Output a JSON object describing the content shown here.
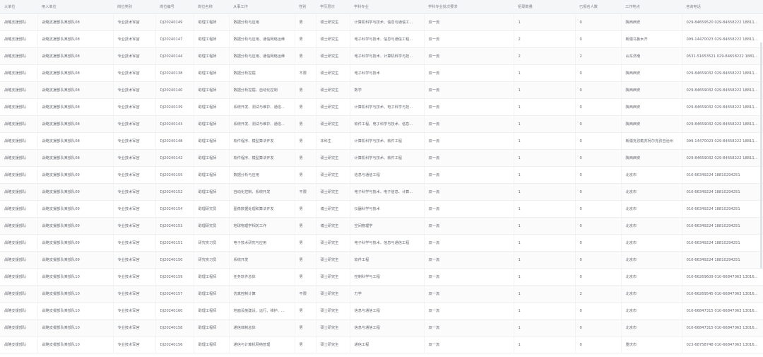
{
  "columns": [
    "大单位",
    "用人单位",
    "岗位类别",
    "岗位编号",
    "岗位名称",
    "从事工作",
    "性别",
    "学历层次",
    "学科专业",
    "学科专业批次要求",
    "招录数量",
    "已报名人数",
    "工作地点",
    "咨询电话"
  ],
  "rows": [
    [
      "战略支援部队",
      "战略支援部队某部队08",
      "专业技术军官",
      "DJ20240149",
      "助理工程师",
      "数据分析与应用",
      "男",
      "硕士研究生",
      "计算机科学与技术、信息与通信工...",
      "双一流",
      "1",
      "0",
      "陕西西安",
      "029-84659520 029-84658222 18811..."
    ],
    [
      "战略支援部队",
      "战略支援部队某部队08",
      "专业技术军官",
      "DJ20240147",
      "助理工程师",
      "数据分析与应用、通信网络运维",
      "男",
      "硕士研究生",
      "电子科学与技术、信息与通信工程...",
      "双一流",
      "2",
      "0",
      "新疆乌鲁木齐",
      "099-14470023 029-84658222 18811..."
    ],
    [
      "战略支援部队",
      "战略支援部队某部队08",
      "专业技术军官",
      "DJ20240144",
      "助理工程师",
      "数据分析与应用、通信网络运维",
      "男",
      "硕士研究生",
      "电子科学与技术、计算机科学与技...",
      "双一流",
      "2",
      "2",
      "山东济南",
      "0531-51653521 029-84658222 1881..."
    ],
    [
      "战略支援部队",
      "战略支援部队某部队08",
      "专业技术军官",
      "DJ20240138",
      "助理工程师",
      "数据分析挖掘",
      "不限",
      "硕士研究生",
      "电子科学与技术",
      "双一流",
      "1",
      "0",
      "陕西西安",
      "029-84659032 029-84658222 18811..."
    ],
    [
      "战略支援部队",
      "战略支援部队某部队08",
      "专业技术军官",
      "DJ20240140",
      "助理工程师",
      "数据分析挖掘、自动化控制",
      "男",
      "硕士研究生",
      "数学",
      "双一流",
      "1",
      "0",
      "陕西西安",
      "029-84659032 029-84658222 18811..."
    ],
    [
      "战略支援部队",
      "战略支援部队某部队08",
      "专业技术军官",
      "DJ20240139",
      "助理工程师",
      "系统开发、测试与维护、通信...",
      "男",
      "硕士研究生",
      "计算机科学与技术、电子科学与技...",
      "双一流",
      "1",
      "0",
      "陕西西安",
      "029-84659032 029-84658222 18811..."
    ],
    [
      "战略支援部队",
      "战略支援部队某部队08",
      "专业技术军官",
      "DJ20240143",
      "助理工程师",
      "系统开发、测试与维护、通信...",
      "男",
      "硕士研究生",
      "软件工程、电子科学与技术、信息...",
      "双一流",
      "1",
      "0",
      "陕西西安",
      "029-84659032 029-84658222 18811..."
    ],
    [
      "战略支援部队",
      "战略支援部队某部队08",
      "专业技术军官",
      "DJ20240148",
      "助理工程师",
      "软件程序、模型算法开发",
      "男",
      "本科生",
      "计算机科学与技术、软件工程",
      "双一流",
      "1",
      "0",
      "新疆克孜勒苏柯尔克孜自治州",
      "099-14470023 029-84658222 18811..."
    ],
    [
      "战略支援部队",
      "战略支援部队某部队08",
      "专业技术军官",
      "DJ20240142",
      "助理工程师",
      "软件程序、模型算法开发",
      "男",
      "硕士研究生",
      "计算机科学与技术、软件工程",
      "双一流",
      "1",
      "0",
      "陕西西安",
      "029-84659032 029-84658222 18811..."
    ],
    [
      "战略支援部队",
      "战略支援部队某部队09",
      "专业技术军官",
      "DJ20240155",
      "助理工程师",
      "数据分析与应用",
      "男",
      "硕士研究生",
      "信息与通信工程",
      "双一流",
      "1",
      "0",
      "北京市",
      "010-66349224 18810294251"
    ],
    [
      "战略支援部队",
      "战略支援部队某部队09",
      "专业技术军官",
      "DJ20240152",
      "助理工程师",
      "自动化控制、系统开发",
      "不限",
      "硕士研究生",
      "电子科学与技术、电子信息、计算...",
      "双一流",
      "1",
      "0",
      "北京市",
      "010-66349224 18810294251"
    ],
    [
      "战略支援部队",
      "战略支援部队某部队09",
      "专业技术军官",
      "DJ20240154",
      "助理研究员",
      "图像数据处理和算法开发",
      "男",
      "博士研究生",
      "仪器科学与技术",
      "双一流",
      "1",
      "0",
      "北京市",
      "010-66349224 18810294251"
    ],
    [
      "战略支援部队",
      "战略支援部队某部队09",
      "专业技术军官",
      "DJ20240153",
      "助理研究员",
      "地球物理学相关工作",
      "男",
      "博士研究生",
      "空间物理学",
      "双一流",
      "1",
      "0",
      "北京市",
      "010-66349224 18810294251"
    ],
    [
      "战略支援部队",
      "战略支援部队某部队09",
      "专业技术军官",
      "DJ20240151",
      "研究实习员",
      "电子技术研究与应用",
      "男",
      "硕士研究生",
      "电子科学与技术、信息与通信工程",
      "双一流",
      "1",
      "0",
      "北京市",
      "010-66349224 18810294251"
    ],
    [
      "战略支援部队",
      "战略支援部队某部队09",
      "专业技术军官",
      "DJ20240150",
      "研究实习员",
      "系统开发",
      "男",
      "硕士研究生",
      "软件工程",
      "双一流",
      "1",
      "0",
      "北京市",
      "010-66349224 18810294251"
    ],
    [
      "战略支援部队",
      "战略支援部队某部队10",
      "专业技术军官",
      "DJ20240159",
      "助理工程师",
      "任务软件总体",
      "男",
      "硕士研究生",
      "控制科学与工程",
      "双一流",
      "1",
      "0",
      "北京市",
      "010-66269609 010-66847063 13016..."
    ],
    [
      "战略支援部队",
      "战略支援部队某部队10",
      "专业技术军官",
      "DJ20240157",
      "助理工程师",
      "仿真控制计算",
      "不限",
      "硕士研究生",
      "力学",
      "双一流",
      "1",
      "2",
      "北京市",
      "010-66269545 010-66847063 13016..."
    ],
    [
      "战略支援部队",
      "战略支援部队某部队10",
      "专业技术军官",
      "DJ20240160",
      "助理工程师",
      "地面设施建设、运行、维护、...",
      "男",
      "硕士研究生",
      "信息与通信工程",
      "双一流",
      "1",
      "0",
      "北京市",
      "010-66847315 010-66847063 13016..."
    ],
    [
      "战略支援部队",
      "战略支援部队某部队10",
      "专业技术军官",
      "DJ20240158",
      "助理工程师",
      "通信体制总体",
      "男",
      "硕士研究生",
      "信息与通信工程",
      "双一流",
      "1",
      "0",
      "北京市",
      "010-66847315 010-66847063 13016..."
    ],
    [
      "战略支援部队",
      "战略支援部队某部队10",
      "专业技术军官",
      "DJ20240156",
      "助理工程师",
      "通信与计算机网络管理",
      "男",
      "硕士研究生",
      "通信工程",
      "双一流",
      "1",
      "0",
      "重庆市",
      "023-68758748 010-66847063 13016..."
    ]
  ]
}
